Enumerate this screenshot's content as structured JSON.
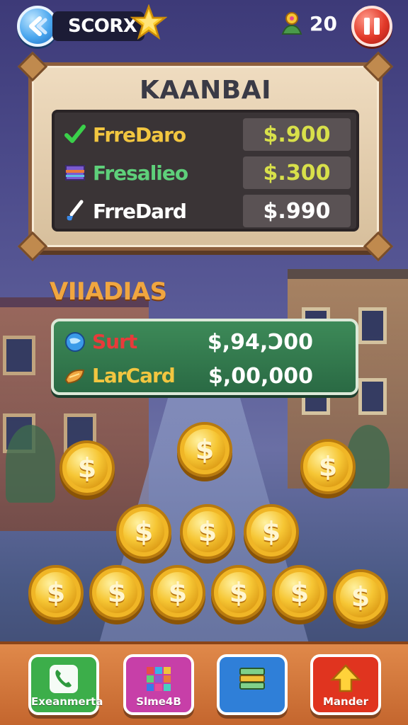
{
  "topbar": {
    "title": "SCORX",
    "coin_count": "20"
  },
  "panel": {
    "title": "KAANBAI",
    "rows": [
      {
        "label": "FrreDaro",
        "value": "$.900",
        "label_color": "#f2c640",
        "value_color": "#d8e04a",
        "icon": "checkmark-icon"
      },
      {
        "label": "Fresalieo",
        "value": "$.300",
        "label_color": "#5ed07a",
        "value_color": "#d8e04a",
        "icon": "book-icon"
      },
      {
        "label": "FrreDard",
        "value": "$.990",
        "label_color": "#ffffff",
        "value_color": "#ffffff",
        "icon": "brush-icon"
      }
    ]
  },
  "section": {
    "title": "VIIADIAS",
    "rows": [
      {
        "label": "Surt",
        "value": "$,94,Ɔ00",
        "label_color": "#e83a3a",
        "icon": "globe-icon"
      },
      {
        "label": "LarCard",
        "value": "$,00,000",
        "label_color": "#f2c640",
        "icon": "card-icon"
      }
    ]
  },
  "coins": {
    "symbol": "$"
  },
  "bottom": {
    "buttons": [
      {
        "label": "Exeanmerta",
        "color": "#3cae4a",
        "icon": "phone-icon"
      },
      {
        "label": "Slme4B",
        "color": "#c73fa8",
        "icon": "grid-icon"
      },
      {
        "label": "",
        "color": "#2f7fd8",
        "icon": "cash-stack-icon"
      },
      {
        "label": "Mander",
        "color": "#e0341f",
        "icon": "up-arrow-icon"
      }
    ]
  }
}
